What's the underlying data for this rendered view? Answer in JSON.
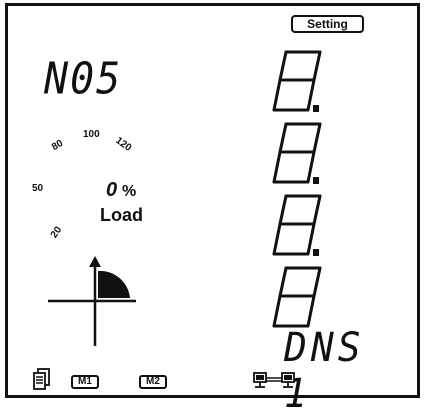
{
  "header": {
    "setting_label": "Setting"
  },
  "device": {
    "number": "N05",
    "dns_label": "DNS 1"
  },
  "load_gauge": {
    "scale_labels": [
      "20",
      "50",
      "80",
      "100",
      "120"
    ],
    "value": "0",
    "unit": "%",
    "label": "Load"
  },
  "main_display": {
    "digits": [
      "8",
      "8",
      "8",
      "8"
    ],
    "decimal_points": [
      true,
      true,
      true,
      false
    ]
  },
  "footer": {
    "m1_label": "M1",
    "m2_label": "M2"
  },
  "icons": {
    "quadrant": "power-quadrant-icon",
    "device": "device-icon",
    "network": "network-link-icon"
  }
}
